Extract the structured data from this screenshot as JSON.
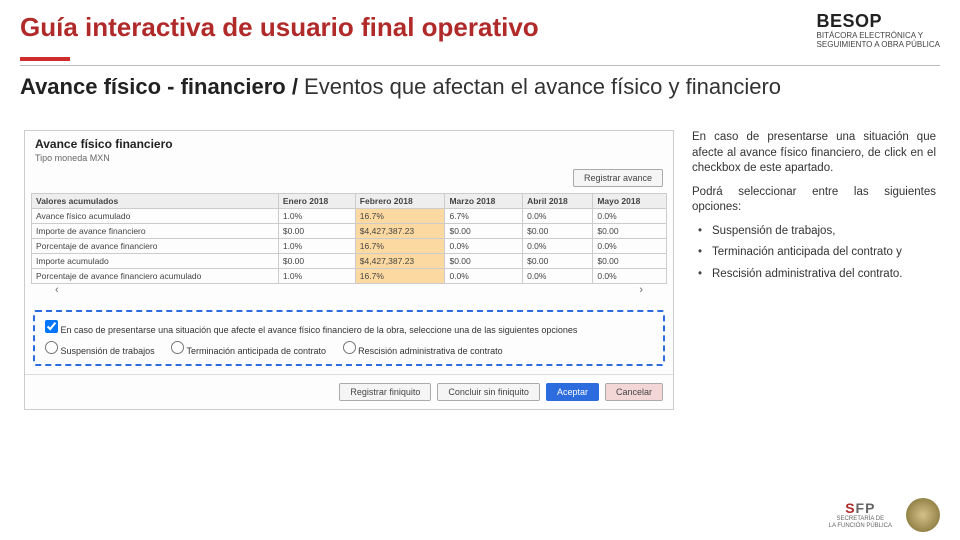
{
  "header": {
    "title": "Guía interactiva de usuario final operativo",
    "logo_brand": "BESOP",
    "logo_line1": "BITÁCORA ELECTRÓNICA Y",
    "logo_line2": "SEGUIMIENTO A OBRA PÚBLICA"
  },
  "subtitle": {
    "strong": "Avance físico - financiero /",
    "rest": " Eventos que afectan el avance físico y financiero"
  },
  "app": {
    "panel_title": "Avance físico financiero",
    "currency_label": "Tipo moneda MXN",
    "register_advance_btn": "Registrar avance",
    "cols": {
      "c0": "Valores acumulados",
      "c1": "Enero 2018",
      "c2": "Febrero 2018",
      "c3": "Marzo 2018",
      "c4": "Abril 2018",
      "c5": "Mayo 2018"
    },
    "rows": {
      "r0": {
        "label": "Avance físico acumulado",
        "v1": "1.0%",
        "v2": "16.7%",
        "v3": "6.7%",
        "v4": "0.0%",
        "v5": "0.0%"
      },
      "r1": {
        "label": "Importe de avance financiero",
        "v1": "$0.00",
        "v2": "$4,427,387.23",
        "v3": "$0.00",
        "v4": "$0.00",
        "v5": "$0.00"
      },
      "r2": {
        "label": "Porcentaje de avance financiero",
        "v1": "1.0%",
        "v2": "16.7%",
        "v3": "0.0%",
        "v4": "0.0%",
        "v5": "0.0%"
      },
      "r3": {
        "label": "Importe acumulado",
        "v1": "$0.00",
        "v2": "$4,427,387.23",
        "v3": "$0.00",
        "v4": "$0.00",
        "v5": "$0.00"
      },
      "r4": {
        "label": "Porcentaje de avance financiero acumulado",
        "v1": "1.0%",
        "v2": "16.7%",
        "v3": "0.0%",
        "v4": "0.0%",
        "v5": "0.0%"
      }
    },
    "event_head": "En caso de presentarse una situación que afecte el avance físico financiero de la obra, seleccione una de las siguientes opciones",
    "opt1": "Suspensión de trabajos",
    "opt2": "Terminación anticipada de contrato",
    "opt3": "Rescisión administrativa de contrato",
    "footer_btns": {
      "b1": "Registrar finiquito",
      "b2": "Concluir sin finiquito",
      "b3": "Aceptar",
      "b4": "Cancelar"
    }
  },
  "sidetext": {
    "p1": "En caso de presentarse una situación que afecte al avance físico financiero, de click en el checkbox de este apartado.",
    "p2": "Podrá seleccionar entre las siguientes opciones:",
    "li1": "Suspensión de trabajos,",
    "li2": "Terminación anticipada del contrato y",
    "li3": "Rescisión administrativa del contrato."
  },
  "footer": {
    "sfp": "SFP",
    "sfp_line1": "SECRETARÍA DE",
    "sfp_line2": "LA FUNCIÓN PÚBLICA"
  }
}
